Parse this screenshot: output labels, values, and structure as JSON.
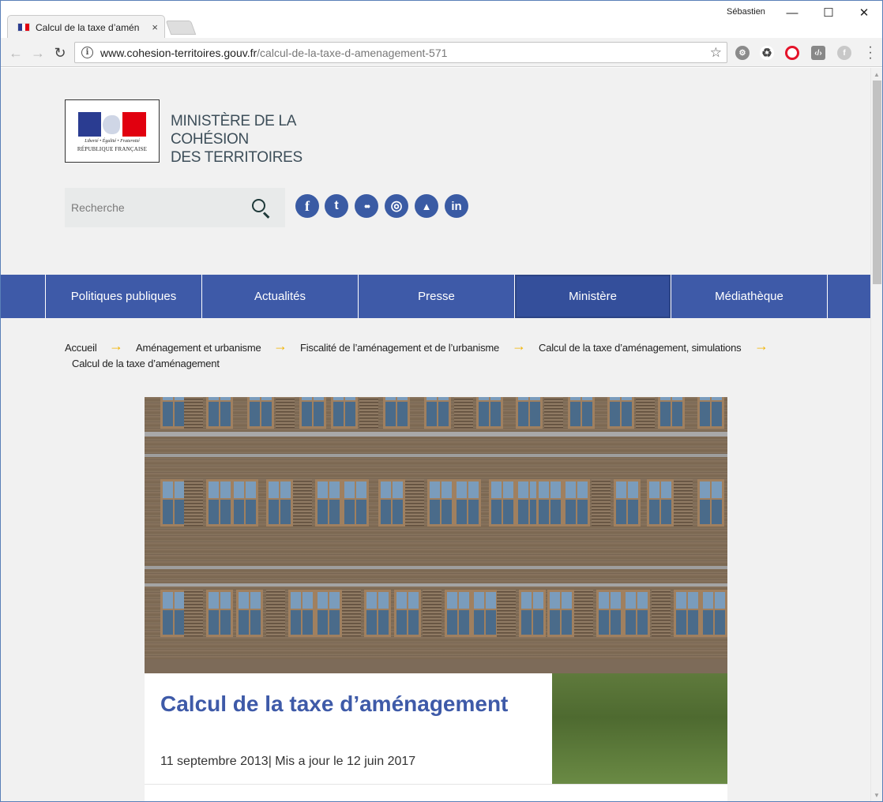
{
  "browser": {
    "tab_title": "Calcul de la taxe d’amén",
    "tab_close": "×",
    "profile_name": "Sébastien",
    "url_host": "www.cohesion-territoires.gouv.fr",
    "url_path": "/calcul-de-la-taxe-d-amenagement-571",
    "window_controls": [
      "—",
      "☐",
      "✕"
    ]
  },
  "header": {
    "motto": "Liberté • Égalité • Fraternité",
    "republic": "RÉPUBLIQUE FRANÇAISE",
    "ministry_line1": "MINISTÈRE DE LA",
    "ministry_line2": "COHÉSION",
    "ministry_line3": "DES TERRITOIRES",
    "search_placeholder": "Recherche",
    "social": [
      {
        "icon": "facebook-icon",
        "glyph": "f"
      },
      {
        "icon": "twitter-icon",
        "glyph": "t"
      },
      {
        "icon": "flickr-icon",
        "glyph": "••"
      },
      {
        "icon": "instagram-icon",
        "glyph": "◎"
      },
      {
        "icon": "dailymotion-icon",
        "glyph": "▲"
      },
      {
        "icon": "linkedin-icon",
        "glyph": "in"
      }
    ]
  },
  "nav": {
    "items": [
      "Politiques publiques",
      "Actualités",
      "Presse",
      "Ministère",
      "Médiathèque"
    ],
    "active": "Ministère"
  },
  "breadcrumb": {
    "items": [
      "Accueil",
      "Aménagement et urbanisme",
      "Fiscalité de l’aménagement et de l’urbanisme",
      "Calcul de la taxe d’aménagement, simulations"
    ],
    "current": "Calcul de la taxe d’aménagement",
    "separator": "→"
  },
  "article": {
    "title": "Calcul de la taxe d’aménagement",
    "date": "11 septembre 2013| Mis a jour le 12 juin 2017"
  },
  "colors": {
    "nav_blue": "#3e5aa8",
    "title_blue": "#3e5aa8",
    "arrow_yellow": "#f2b400",
    "page_bg": "#f1f1f1"
  }
}
